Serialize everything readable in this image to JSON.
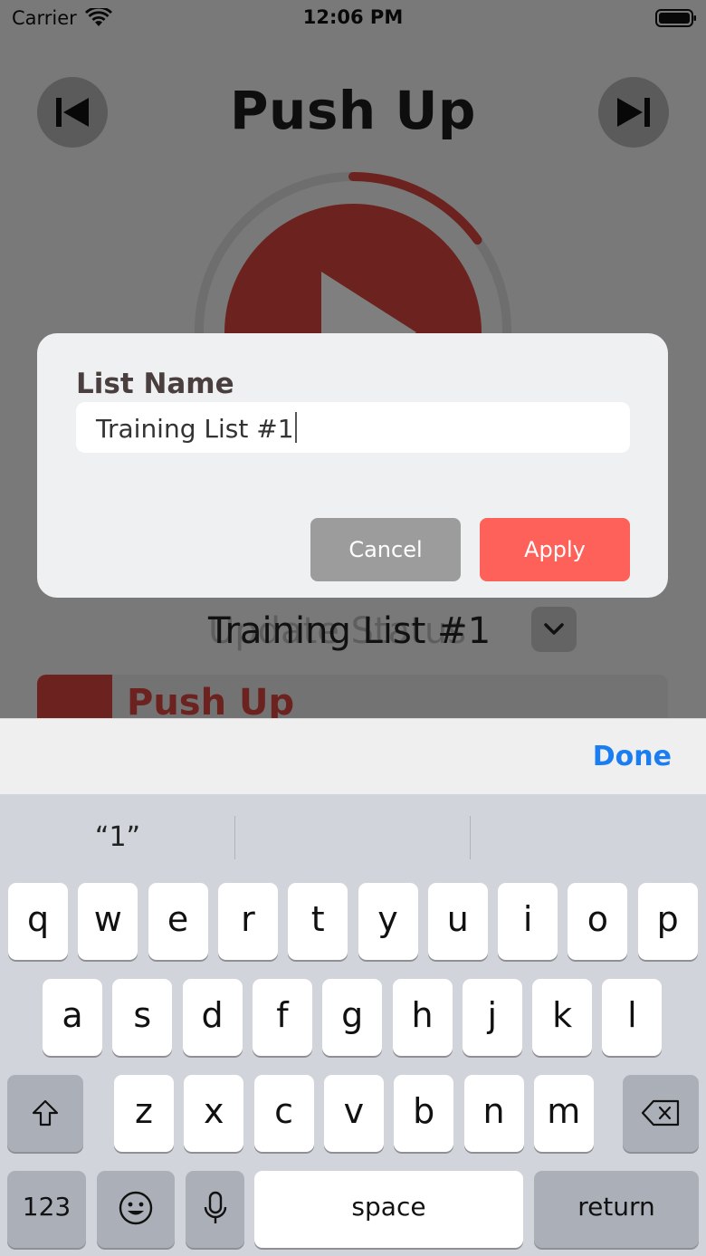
{
  "status_bar": {
    "carrier": "Carrier",
    "time": "12:06 PM"
  },
  "screen": {
    "exercise_title": "Push Up",
    "current_list": "Training List #1",
    "ghost_label": "Update Status",
    "timer_progress": 0.15,
    "exercise_row_title": "Push Up",
    "accent_color": "#d9463e"
  },
  "dialog": {
    "label": "List Name",
    "input_value": "Training List #1",
    "cancel_label": "Cancel",
    "apply_label": "Apply"
  },
  "keyboard_toolbar": {
    "done_label": "Done"
  },
  "keyboard": {
    "suggestions": [
      "“1”",
      "",
      ""
    ],
    "row1": [
      "q",
      "w",
      "e",
      "r",
      "t",
      "y",
      "u",
      "i",
      "o",
      "p"
    ],
    "row2": [
      "a",
      "s",
      "d",
      "f",
      "g",
      "h",
      "j",
      "k",
      "l"
    ],
    "row3": [
      "z",
      "x",
      "c",
      "v",
      "b",
      "n",
      "m"
    ],
    "numbers_label": "123",
    "space_label": "space",
    "return_label": "return"
  }
}
